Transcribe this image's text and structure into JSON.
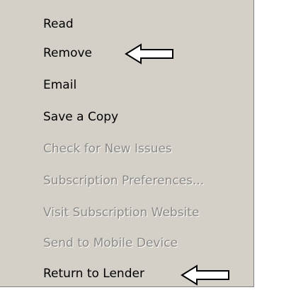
{
  "menu": {
    "items": [
      {
        "label": "Read",
        "enabled": true
      },
      {
        "label": "Remove",
        "enabled": true
      },
      {
        "label": "Email",
        "enabled": true
      },
      {
        "label": "Save a Copy",
        "enabled": true
      },
      {
        "label": "Check for New Issues",
        "enabled": false
      },
      {
        "label": "Subscription Preferences...",
        "enabled": false
      },
      {
        "label": "Visit Subscription Website",
        "enabled": false
      },
      {
        "label": "Send to Mobile Device",
        "enabled": false
      },
      {
        "label": "Return to Lender",
        "enabled": true
      }
    ]
  },
  "annotations": {
    "arrow_icon": "left-arrow-icon",
    "arrow_fill": "#ffffff",
    "arrow_stroke": "#000000"
  },
  "colors": {
    "menu_background": "#d4d0c8",
    "enabled_text": "#000000",
    "disabled_text": "#8c8a86"
  }
}
